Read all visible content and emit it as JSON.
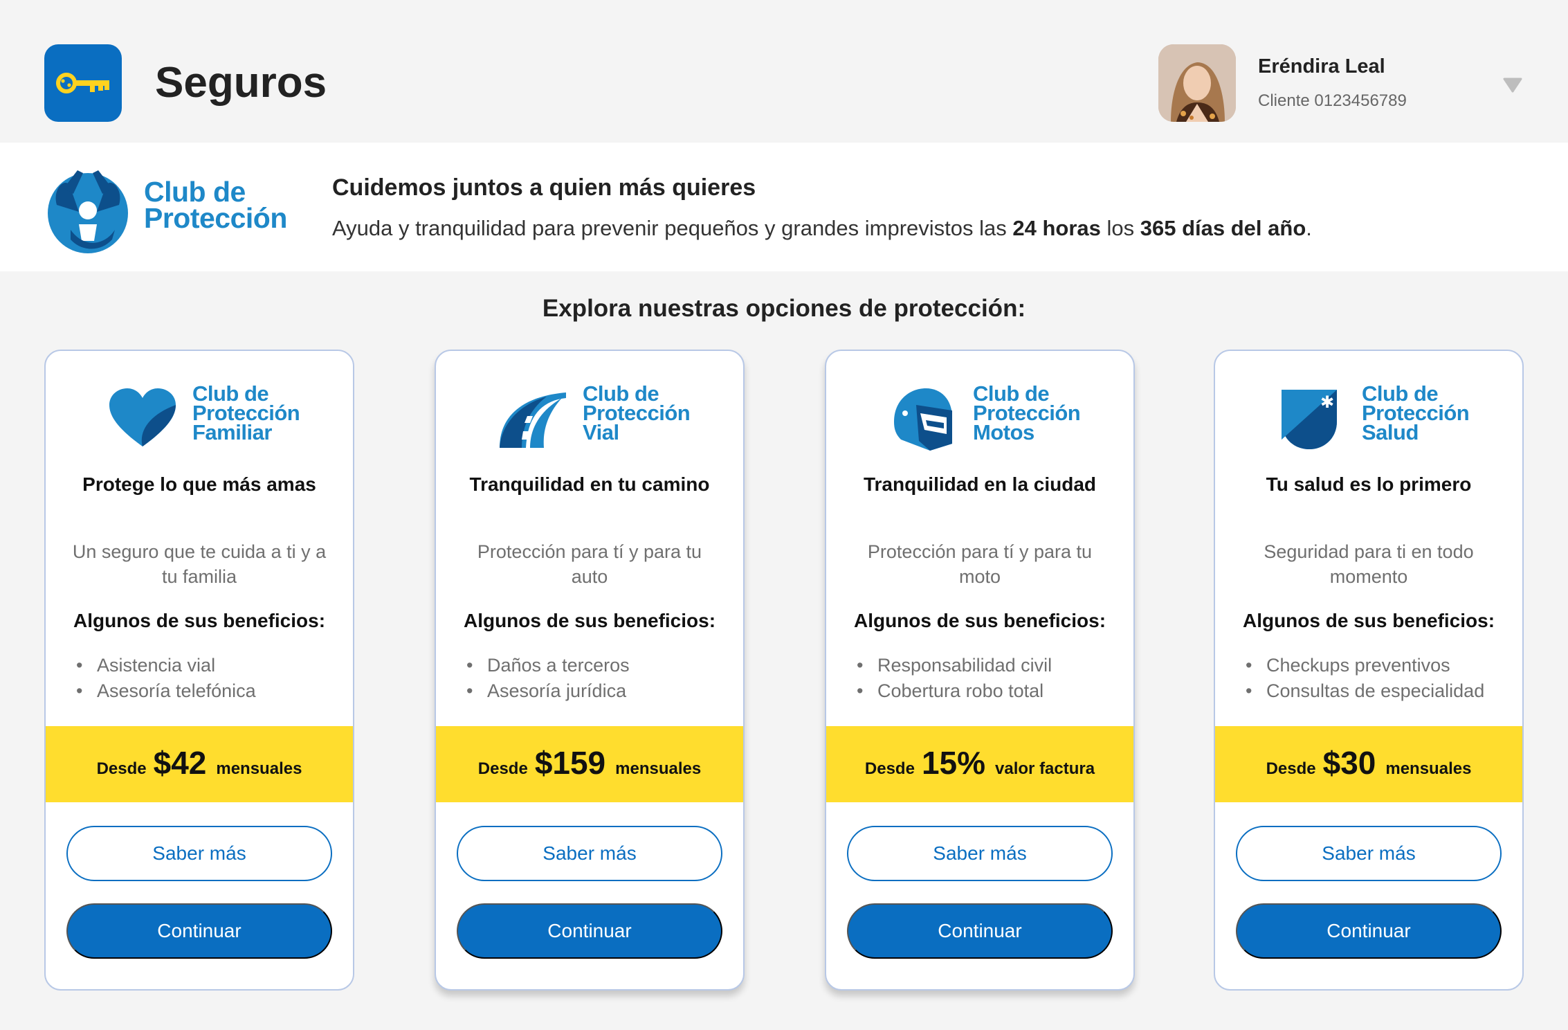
{
  "header": {
    "app_title": "Seguros",
    "app_icon": "key-icon",
    "user": {
      "name": "Eréndira Leal",
      "client_id": "Cliente 0123456789"
    }
  },
  "banner": {
    "logo_line1": "Club de",
    "logo_line2": "Protección",
    "title": "Cuidemos juntos a quien más quieres",
    "text_before": "Ayuda y tranquilidad para prevenir pequeños y grandes imprevistos las ",
    "bold1": "24 horas",
    "text_middle": " los ",
    "bold2": "365 días del año",
    "text_after": "."
  },
  "section_title": "Explora nuestras opciones de protección:",
  "colors": {
    "primary": "#0a6ec1",
    "accent_yellow": "#ffdd2e",
    "logo_blue": "#1e88c8",
    "dark_blue": "#0d4f8b"
  },
  "cards": [
    {
      "logo_line1": "Club de",
      "logo_line2": "Protección",
      "logo_line3": "Familiar",
      "icon": "heart-icon",
      "title": "Protege lo que más amas",
      "description": "Un seguro que te cuida a ti y a tu familia",
      "benefits_title": "Algunos de sus beneficios:",
      "benefits": [
        "Asistencia vial",
        "Asesoría telefónica"
      ],
      "price_prefix": "Desde",
      "price": "$42",
      "price_suffix": "mensuales",
      "more_label": "Saber más",
      "continue_label": "Continuar"
    },
    {
      "logo_line1": "Club de",
      "logo_line2": "Protección",
      "logo_line3": "Vial",
      "icon": "road-icon",
      "title": "Tranquilidad en tu camino",
      "description": "Protección para tí y para tu auto",
      "benefits_title": "Algunos de sus beneficios:",
      "benefits": [
        "Daños a terceros",
        "Asesoría jurídica"
      ],
      "price_prefix": "Desde",
      "price": "$159",
      "price_suffix": "mensuales",
      "more_label": "Saber más",
      "continue_label": "Continuar"
    },
    {
      "logo_line1": "Club de",
      "logo_line2": "Protección",
      "logo_line3": "Motos",
      "icon": "helmet-icon",
      "title": "Tranquilidad en la ciudad",
      "description": "Protección para tí y para tu moto",
      "benefits_title": "Algunos de sus beneficios:",
      "benefits": [
        "Responsabilidad civil",
        "Cobertura robo total"
      ],
      "price_prefix": "Desde",
      "price": "15%",
      "price_suffix": "valor factura",
      "more_label": "Saber más",
      "continue_label": "Continuar"
    },
    {
      "logo_line1": "Club de",
      "logo_line2": "Protección",
      "logo_line3": "Salud",
      "icon": "health-shield-icon",
      "title": "Tu salud es lo primero",
      "description": "Seguridad para ti en todo momento",
      "benefits_title": "Algunos de sus beneficios:",
      "benefits": [
        "Checkups preventivos",
        "Consultas de especialidad"
      ],
      "price_prefix": "Desde",
      "price": "$30",
      "price_suffix": "mensuales",
      "more_label": "Saber más",
      "continue_label": "Continuar"
    }
  ]
}
